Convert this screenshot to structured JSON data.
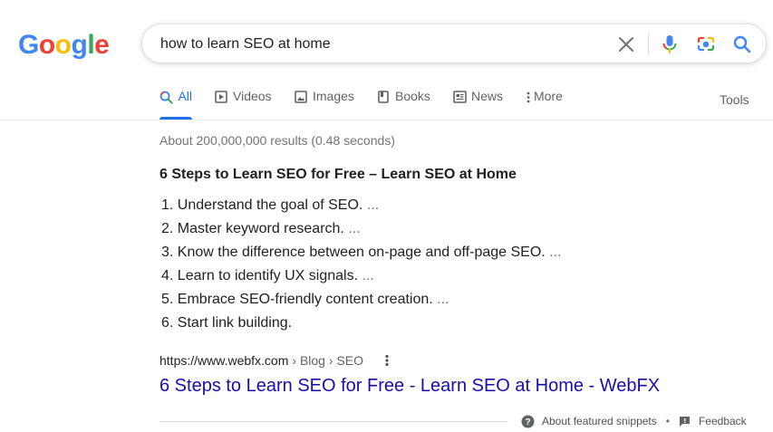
{
  "logo": {
    "letters": [
      "G",
      "o",
      "o",
      "g",
      "l",
      "e"
    ]
  },
  "colors": {
    "blue": "#4285f4",
    "red": "#ea4335",
    "yellow": "#fbbc05",
    "green": "#34a853",
    "link": "#1a0dab",
    "active_tab": "#1a73e8"
  },
  "search": {
    "query": "how to learn SEO at home"
  },
  "tabs": [
    {
      "label": "All",
      "icon": "search-icon",
      "active": true
    },
    {
      "label": "Videos",
      "icon": "play-icon"
    },
    {
      "label": "Images",
      "icon": "image-icon"
    },
    {
      "label": "Books",
      "icon": "book-icon"
    },
    {
      "label": "News",
      "icon": "news-icon"
    },
    {
      "label": "More",
      "icon": "more-vert-icon"
    }
  ],
  "tools_label": "Tools",
  "results_count": "About 200,000,000 results (0.48 seconds)",
  "snippet": {
    "title": "6 Steps to Learn SEO for Free – Learn SEO at Home",
    "items": [
      {
        "num": "1.",
        "text": "Understand the goal of SEO.",
        "ellipsis": "..."
      },
      {
        "num": "2.",
        "text": "Master keyword research.",
        "ellipsis": "..."
      },
      {
        "num": "3.",
        "text": "Know the difference between on-page and off-page SEO.",
        "ellipsis": "..."
      },
      {
        "num": "4.",
        "text": "Learn to identify UX signals.",
        "ellipsis": "..."
      },
      {
        "num": "5.",
        "text": "Embrace SEO-friendly content creation.",
        "ellipsis": "..."
      },
      {
        "num": "6.",
        "text": "Start link building.",
        "ellipsis": ""
      }
    ]
  },
  "result": {
    "domain": "https://www.webfx.com",
    "path": "› Blog › SEO",
    "title": "6 Steps to Learn SEO for Free - Learn SEO at Home - WebFX"
  },
  "footer": {
    "about": "About featured snippets",
    "separator": "•",
    "feedback": "Feedback"
  }
}
